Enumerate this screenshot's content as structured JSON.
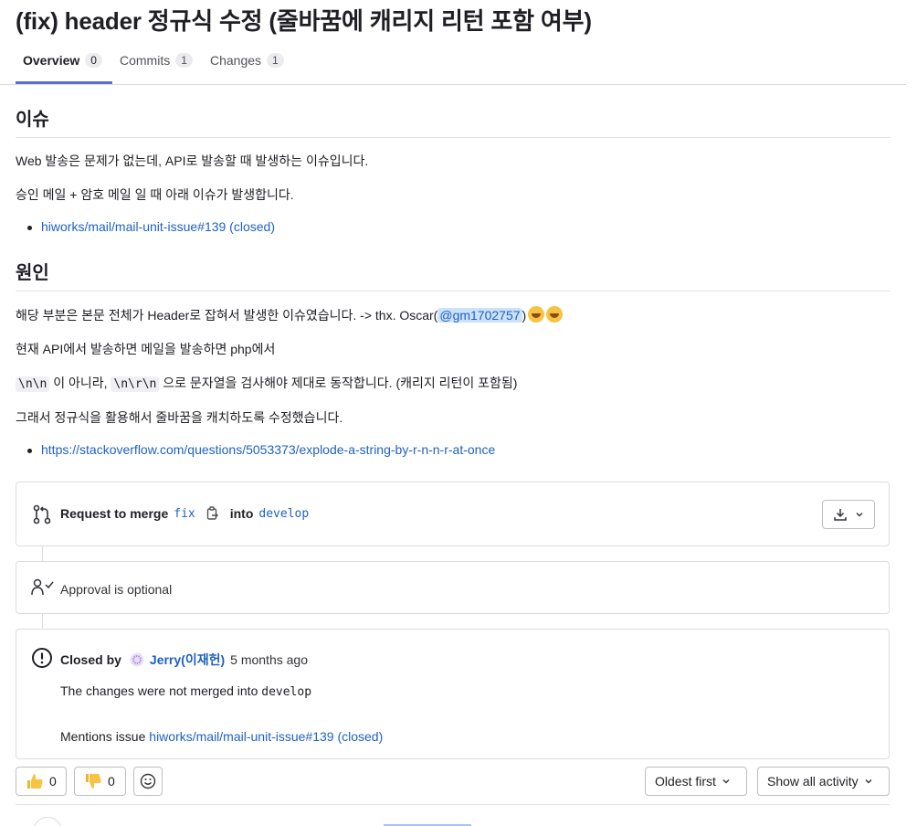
{
  "title": "(fix) header 정규식 수정 (줄바꿈에 캐리지 리턴 포함 여부)",
  "tabs": [
    {
      "label": "Overview",
      "count": "0"
    },
    {
      "label": "Commits",
      "count": "1"
    },
    {
      "label": "Changes",
      "count": "1"
    }
  ],
  "description": {
    "issue_heading": "이슈",
    "issue_p1": "Web 발송은 문제가 없는데, API로 발송할 때 발생하는 이슈입니다.",
    "issue_p2": "승인 메일 + 암호 메일 일 때 아래 이슈가 발생합니다.",
    "issue_link": "hiworks/mail/mail-unit-issue#139 (closed)",
    "cause_heading": "원인",
    "cause_p1_before": "해당 부분은 본문 전체가 Header로 잡혀서 발생한 이슈였습니다. -> thx. Oscar(",
    "cause_p1_mention": "@gm1702757",
    "cause_p1_after": ")",
    "cause_p2": "현재 API에서 발송하면 메일을 발송하면 php에서",
    "cause_p3_code1": "\\n\\n",
    "cause_p3_mid": " 이 아니라, ",
    "cause_p3_code2": "\\n\\r\\n",
    "cause_p3_end": " 으로 문자열을 검사해야 제대로 동작합니다. (캐리지 리턴이 포함됨)",
    "cause_p4": "그래서 정규식을 활용해서 줄바꿈을 캐치하도록 수정했습니다.",
    "cause_link": "https://stackoverflow.com/questions/5053373/explode-a-string-by-r-n-n-r-at-once"
  },
  "merge_widget": {
    "request_label": "Request to merge",
    "source_branch": "fix",
    "into_label": "into",
    "target_branch": "develop"
  },
  "approval": {
    "text": "Approval is optional"
  },
  "closed": {
    "closed_by_label": "Closed by",
    "user": "Jerry(이재헌)",
    "time": "5 months ago",
    "not_merged_text": "The changes were not merged into",
    "not_merged_branch": "develop",
    "mentions_label": "Mentions issue",
    "mentions_link": "hiworks/mail/mail-unit-issue#139 (closed)"
  },
  "reactions": {
    "thumbs_up": "0",
    "thumbs_down": "0"
  },
  "sort": {
    "label": "Oldest first"
  },
  "filter": {
    "label": "Show all activity"
  },
  "colors": {
    "link": "#1f61c1",
    "tab_underline": "#5a6fd0"
  }
}
